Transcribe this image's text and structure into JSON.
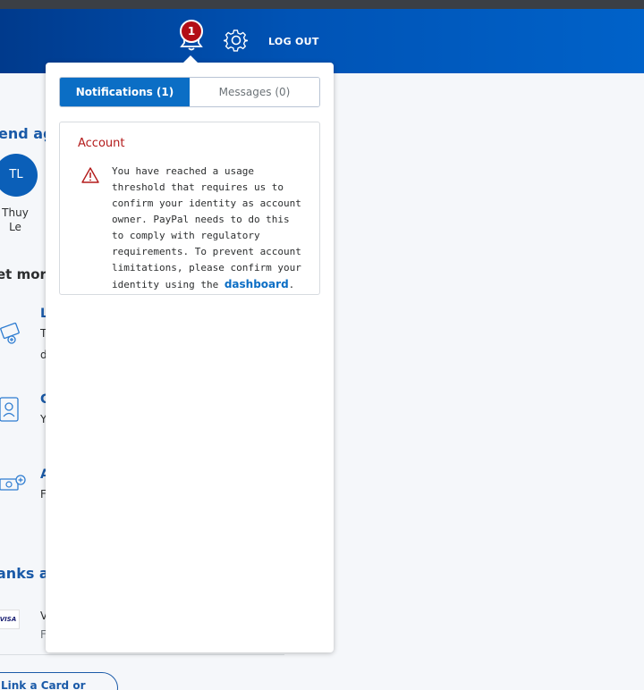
{
  "header": {
    "notification_count": "1",
    "logout_label": "LOG OUT"
  },
  "background": {
    "send_again_heading": "end ag",
    "contact": {
      "initials": "TL",
      "name": "Thuy Le"
    },
    "get_more_heading": "et more",
    "item_fragments": [
      "L",
      "T",
      "d",
      "C",
      "Y",
      "A",
      "F"
    ],
    "banks_heading": "anks a",
    "visa_label": "VISA",
    "visa_fragments": [
      "V",
      "F"
    ],
    "link_card_label": "Link a Card or Bank"
  },
  "dropdown": {
    "tabs": [
      {
        "label": "Notifications (1)",
        "active": true
      },
      {
        "label": "Messages (0)",
        "active": false
      }
    ],
    "notification": {
      "title": "Account",
      "body": "You have reached a usage threshold that requires us to confirm your identity as account owner. PayPal needs to do this to comply with regulatory requirements. To prevent account limitations, please confirm your identity using the ",
      "link_text": "dashboard",
      "suffix": "."
    }
  },
  "colors": {
    "header_blue": "#0053b5",
    "badge_red": "#b30e16",
    "active_tab": "#0b6ec5",
    "alert_red": "#b31a1a",
    "link_blue": "#0b6ec5"
  },
  "icons": [
    "bell-icon",
    "gear-icon",
    "warning-icon",
    "bill-pay-icon",
    "id-card-icon",
    "money-add-icon",
    "visa-logo"
  ]
}
